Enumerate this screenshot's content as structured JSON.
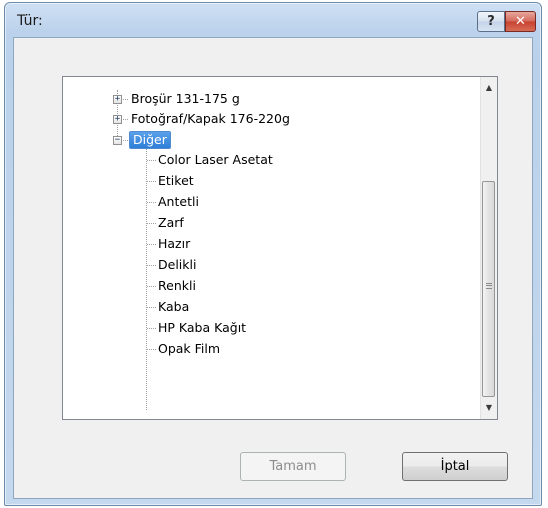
{
  "window": {
    "title": "Tür:",
    "help_glyph": "?",
    "close_glyph": "✕"
  },
  "tree": {
    "top_items": [
      {
        "label": "Broşür 131-175 g",
        "expander": "+"
      },
      {
        "label": "Fotoğraf/Kapak 176-220g",
        "expander": "+"
      },
      {
        "label": "Diğer",
        "expander": "−",
        "selected": true
      }
    ],
    "children": [
      "Color Laser Asetat",
      "Etiket",
      "Antetli",
      "Zarf",
      "Hazır",
      "Delikli",
      "Renkli",
      "Kaba",
      "HP Kaba Kağıt",
      "Opak Film"
    ]
  },
  "scrollbar": {
    "up_arrow": "▲",
    "down_arrow": "▼"
  },
  "buttons": {
    "ok_label": "Tamam",
    "cancel_label": "İptal"
  }
}
